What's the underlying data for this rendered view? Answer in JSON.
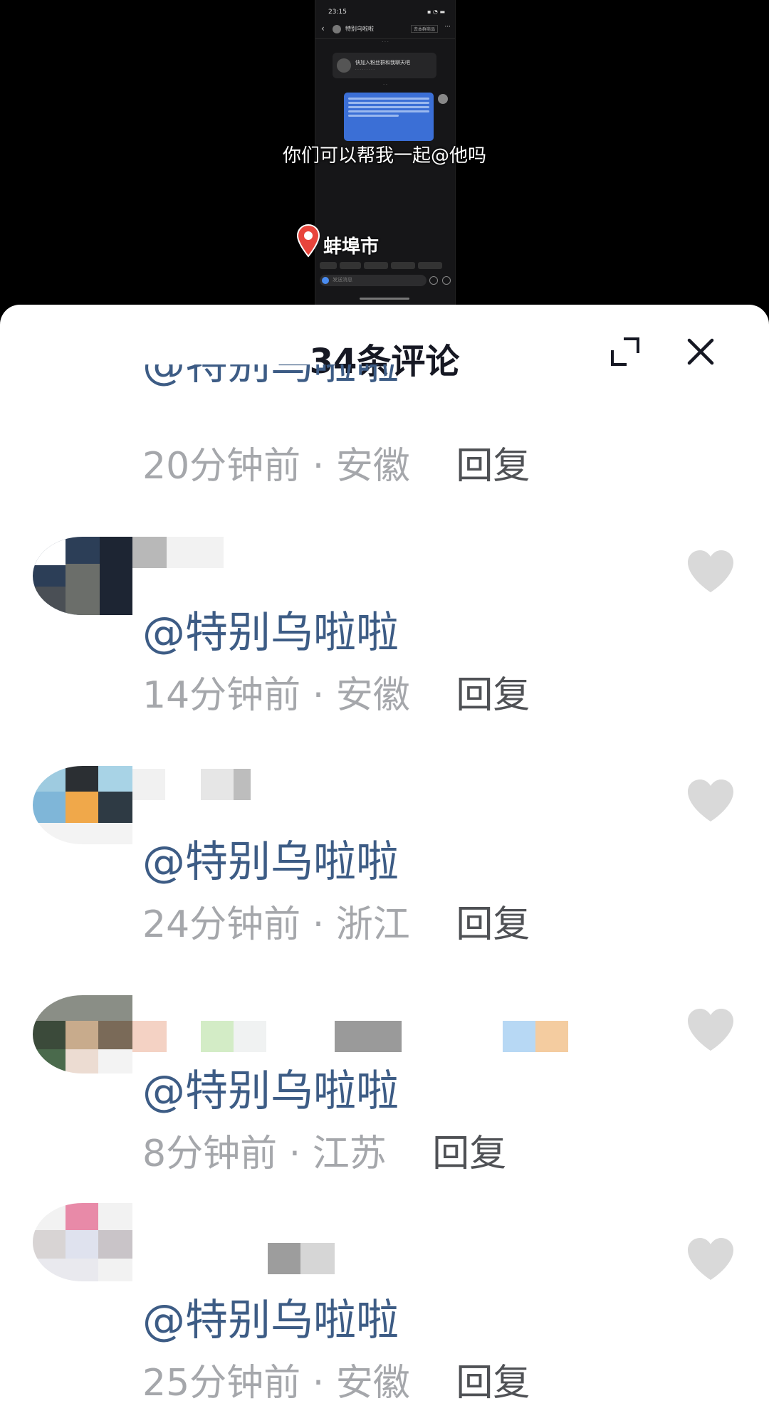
{
  "video": {
    "caption": "你们可以帮我一起@他吗",
    "location": "蚌埠市",
    "phone": {
      "status_time": "23:15",
      "chat_title": "特别乌啦啦",
      "header_button": "去本群商品",
      "card_title": "快加入粉丝群和我聊天吧",
      "input_placeholder": "发送消息"
    }
  },
  "sheet": {
    "title": "34条评论"
  },
  "partial_comment": {
    "handle": "@特别乌啦啦",
    "time": "20分钟前",
    "region": "安徽",
    "reply": "回复"
  },
  "comments": [
    {
      "handle": "@特别乌啦啦",
      "time": "14分钟前",
      "region": "安徽",
      "reply": "回复"
    },
    {
      "handle": "@特别乌啦啦",
      "time": "24分钟前",
      "region": "浙江",
      "reply": "回复"
    },
    {
      "handle": "@特别乌啦啦",
      "time": "8分钟前",
      "region": "江苏",
      "reply": "回复"
    },
    {
      "handle": "@特别乌啦啦",
      "time": "25分钟前",
      "region": "安徽",
      "reply": "回复"
    }
  ],
  "icons": {
    "expand": "expand-icon",
    "close": "close-icon",
    "like": "heart-icon",
    "location": "location-pin-icon"
  },
  "colors": {
    "handle": "#3d5c85",
    "meta": "#a5a7ab",
    "reply": "#4f5155",
    "heart": "#d9d9d9",
    "pin": "#e8453c"
  }
}
